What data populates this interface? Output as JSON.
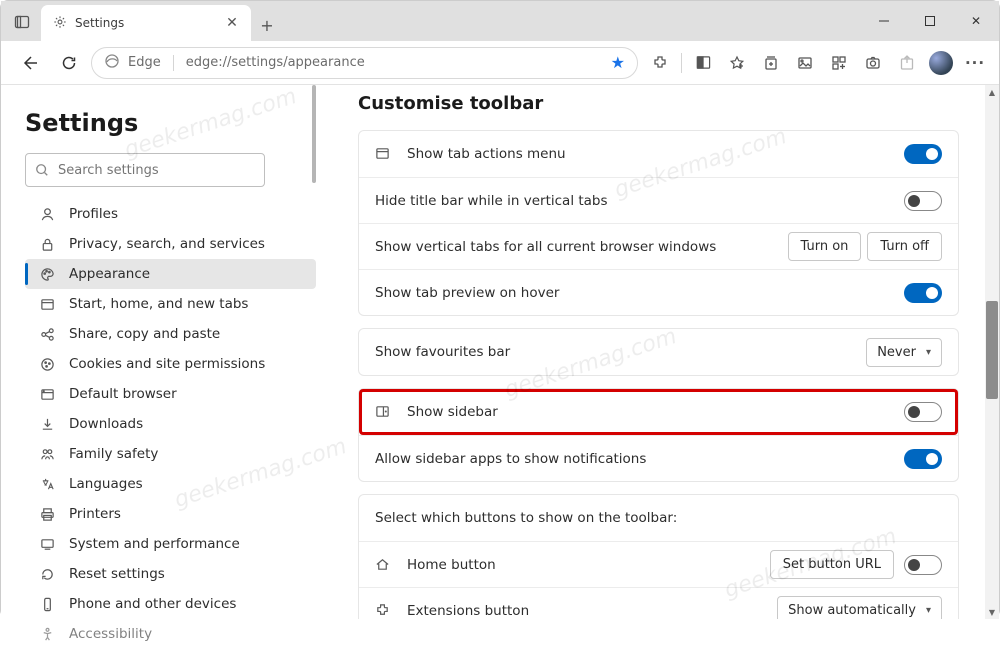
{
  "window": {
    "tab_title": "Settings",
    "browser_name": "Edge",
    "url": "edge://settings/appearance"
  },
  "sidebar": {
    "heading": "Settings",
    "search_placeholder": "Search settings",
    "items": [
      {
        "label": "Profiles"
      },
      {
        "label": "Privacy, search, and services"
      },
      {
        "label": "Appearance"
      },
      {
        "label": "Start, home, and new tabs"
      },
      {
        "label": "Share, copy and paste"
      },
      {
        "label": "Cookies and site permissions"
      },
      {
        "label": "Default browser"
      },
      {
        "label": "Downloads"
      },
      {
        "label": "Family safety"
      },
      {
        "label": "Languages"
      },
      {
        "label": "Printers"
      },
      {
        "label": "System and performance"
      },
      {
        "label": "Reset settings"
      },
      {
        "label": "Phone and other devices"
      },
      {
        "label": "Accessibility"
      }
    ]
  },
  "main": {
    "heading": "Customise toolbar",
    "rows": {
      "show_tab_actions": "Show tab actions menu",
      "hide_title_bar": "Hide title bar while in vertical tabs",
      "show_vertical_tabs": "Show vertical tabs for all current browser windows",
      "tab_preview": "Show tab preview on hover",
      "favourites_bar": "Show favourites bar",
      "show_sidebar": "Show sidebar",
      "allow_sidebar_notif": "Allow sidebar apps to show notifications",
      "select_buttons": "Select which buttons to show on the toolbar:",
      "home_button": "Home button",
      "extensions_button": "Extensions button"
    },
    "buttons": {
      "turn_on": "Turn on",
      "turn_off": "Turn off",
      "never": "Never",
      "set_button_url": "Set button URL",
      "show_automatically": "Show automatically"
    }
  },
  "watermark": "geekermag.com"
}
